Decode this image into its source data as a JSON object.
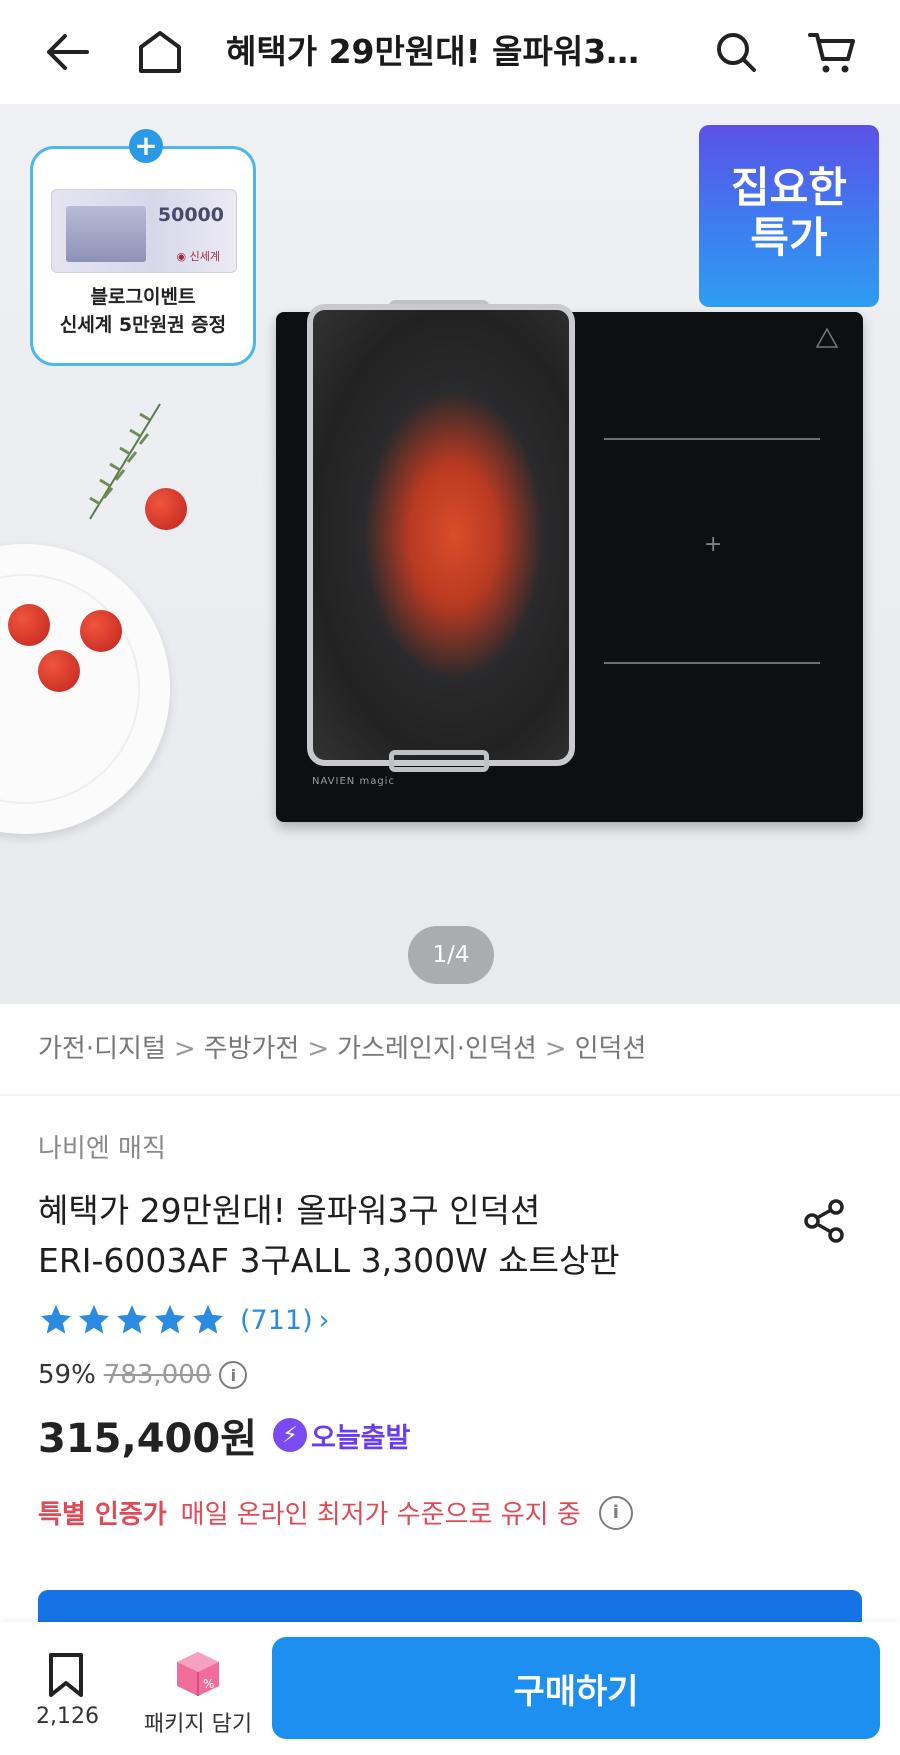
{
  "header": {
    "title": "혜택가 29만원대! 올파워3…",
    "back_icon": "arrow-left-icon",
    "home_icon": "home-icon",
    "search_icon": "search-icon",
    "cart_icon": "cart-icon"
  },
  "hero": {
    "gift": {
      "amount": "50000",
      "line1": "블로그이벤트",
      "line2": "신세계 5만원권 증정"
    },
    "badge": {
      "line1": "집요한",
      "line2": "특가"
    },
    "cooktop_brand": "NAVIEN magic",
    "counter": "1/4"
  },
  "breadcrumb": [
    "가전·디지털",
    "주방가전",
    "가스레인지·인덕션",
    "인덕션"
  ],
  "product": {
    "brand": "나비엔 매직",
    "title_line1": "혜택가 29만원대! 올파워3구 인덕션",
    "title_line2": "ERI-6003AF 3구ALL 3,300W  쇼트상판",
    "rating_stars": 5,
    "review_count": "(711)",
    "discount": "59%",
    "original_price": "783,000",
    "price": "315,400원",
    "delivery": "오늘출발",
    "cert_label": "특별 인증가",
    "cert_desc": "매일 온라인 최저가 수준으로 유지 중"
  },
  "bottom_bar": {
    "bookmark_count": "2,126",
    "package_label": "패키지 담기",
    "buy_label": "구매하기"
  },
  "colors": {
    "accent": "#1c8ff1",
    "star": "#2a8be0",
    "cert": "#e04a57",
    "today": "#6a3cf0"
  }
}
